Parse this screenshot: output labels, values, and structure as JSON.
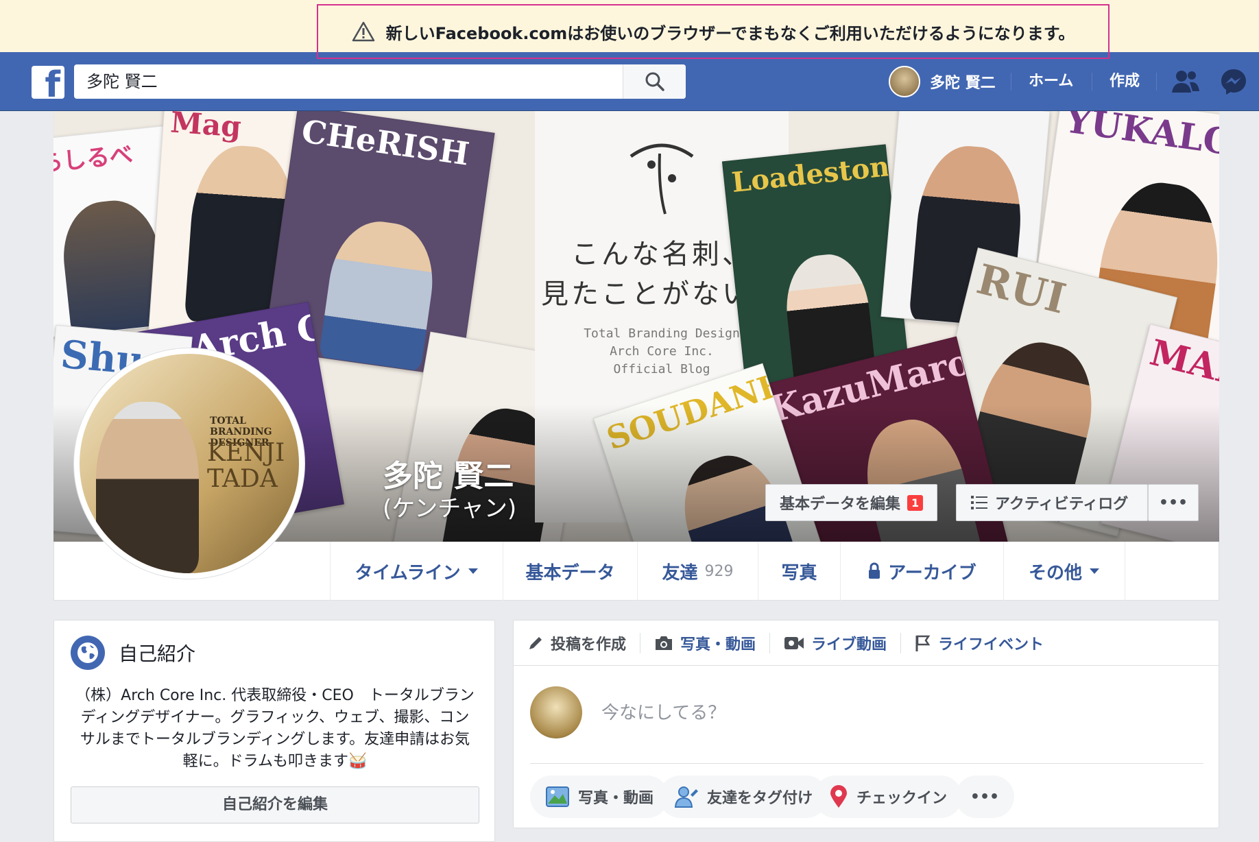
{
  "notice": {
    "text": "新しいFacebook.comはお使いのブラウザーでまもなくご利用いただけるようになります。",
    "icon": "warning-icon"
  },
  "topbar": {
    "search_value": "多陀 賢二",
    "user_name": "多陀 賢二",
    "home": "ホーム",
    "create": "作成",
    "brand_color": "#4267b2"
  },
  "cover": {
    "tagline_1": "こんな名刺、",
    "tagline_2": "見たことがない。",
    "sub_1": "Total Branding Design",
    "sub_2": "Arch Core Inc.",
    "sub_3": "Official Blog",
    "mags": [
      "CHeRISH",
      "Loadestone",
      "YUKALOG",
      "RUI",
      "KazuMaro",
      "SOUDANE",
      "Arch Core",
      "MARI",
      "Shu"
    ]
  },
  "profile": {
    "name": "多陀 賢二",
    "nickname": "(ケンチャン)",
    "edit_basic": "基本データを編集",
    "edit_badge": "1",
    "activity_log": "アクティビティログ",
    "more": "•••",
    "pic_line1": "TOTAL BRANDING",
    "pic_line2": "DESIGNER",
    "pic_line3": "KENJI",
    "pic_line4": "TADA"
  },
  "tabs": {
    "timeline": "タイムライン",
    "about": "基本データ",
    "friends": "友達",
    "friends_count": "929",
    "photos": "写真",
    "archive": "アーカイブ",
    "more": "その他"
  },
  "intro": {
    "title": "自己紹介",
    "text": "（株）Arch Core Inc. 代表取締役・CEO　トータルブランディングデザイナー。グラフィック、ウェブ、撮影、コンサルまでトータルブランディングします。友達申請はお気軽に。ドラムも叩きます🥁",
    "edit": "自己紹介を編集"
  },
  "composer": {
    "create_post": "投稿を作成",
    "photo_video": "写真・動画",
    "live": "ライブ動画",
    "life_event": "ライフイベント",
    "placeholder": "今なにしてる？",
    "pill_photo": "写真・動画",
    "pill_tag": "友達をタグ付け",
    "pill_checkin": "チェックイン",
    "pill_more": "•••"
  }
}
